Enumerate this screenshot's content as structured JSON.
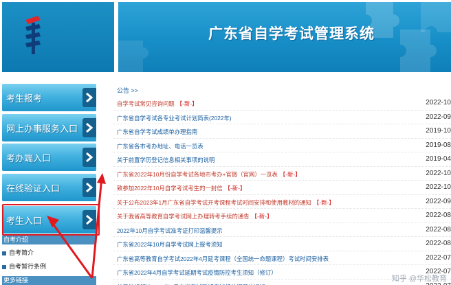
{
  "header": {
    "title": "广东省自学考试管理系统"
  },
  "sidebar": {
    "buttons": [
      {
        "label": "考生报考"
      },
      {
        "label": "网上办事服务入口"
      },
      {
        "label": "考办端入口"
      },
      {
        "label": "在线验证入口"
      },
      {
        "label": "考生入口"
      }
    ],
    "links_header": "自考介绍",
    "links": [
      {
        "label": "自考简介"
      },
      {
        "label": "自考暂行条例"
      }
    ],
    "links_footer": "更多链接"
  },
  "notices": {
    "heading": "公告 >>",
    "items": [
      {
        "title": "自学考试常见咨询问题",
        "tag": "【-新-】",
        "date": "2022-10",
        "color": "#c0392b"
      },
      {
        "title": "广东省自学考试各专业考试计划简表(2022年)",
        "tag": "",
        "date": "2022-09",
        "color": "#1a5fa0"
      },
      {
        "title": "广东省自学考试成绩单办理指南",
        "tag": "",
        "date": "2019-10",
        "color": "#1a5fa0"
      },
      {
        "title": "广东省各市考办地址、电话一览表",
        "tag": "",
        "date": "2019-08",
        "color": "#1a5fa0"
      },
      {
        "title": "关于前置学历登记信息相关事项的说明",
        "tag": "",
        "date": "2019-04",
        "color": "#1a5fa0"
      },
      {
        "title": "广东省2022年10月份自学考试各地市考办+官微（官网）一览表",
        "tag": "【-新-】",
        "date": "2022-10",
        "color": "#c0392b"
      },
      {
        "title": "致参加2022年10月自学考试考生的一封信",
        "tag": "【-新-】",
        "date": "2022-10",
        "color": "#c0392b"
      },
      {
        "title": "关于公布2023年1月广东省自学考试开考课程考试时间安排和使用教材的通知",
        "tag": "【-新-】",
        "date": "2022-09",
        "color": "#c0392b"
      },
      {
        "title": "关于我省高等教育自学考试网上办理转考手续的通告",
        "tag": "【-新-】",
        "date": "2022-08",
        "color": "#c0392b"
      },
      {
        "title": "2022年10月自学考试准考证打印温馨提示",
        "tag": "",
        "date": "2022-08",
        "color": "#1a5fa0"
      },
      {
        "title": "广东省2022年10月自学考试网上报考须知",
        "tag": "",
        "date": "2022-08",
        "color": "#1a5fa0"
      },
      {
        "title": "广东省高等教育自学考试2022年4月延考课程（全国统一命题课程）考试时间安排表",
        "tag": "",
        "date": "2022-07",
        "color": "#1a5fa0"
      },
      {
        "title": "广东省2022年4月自学考试延期考试疫情防控考生须知（修订）",
        "tag": "",
        "date": "2022-07",
        "color": "#1a5fa0"
      },
      {
        "title": "关于做好解决2022年4月自学考试延期考试相关问题的通知",
        "tag": "",
        "date": "2022-07",
        "color": "#1a5fa0"
      }
    ]
  },
  "watermark": "知乎 @华松教育",
  "colors": {
    "banner": "#178ec7",
    "button": "#43b2e0",
    "highlight": "#e0191e"
  }
}
